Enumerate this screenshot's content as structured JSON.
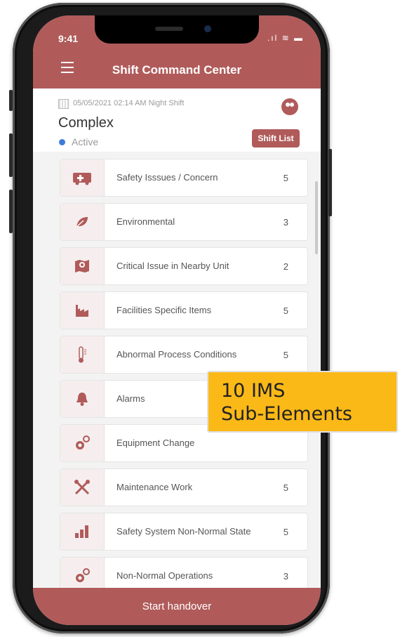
{
  "status_bar": {
    "time": "9:41",
    "icons": ".ıl ≋ ▬"
  },
  "header": {
    "title": "Shift Command Center"
  },
  "info": {
    "datetime": "05/05/2021 02:14 AM Night Shift",
    "site": "Complex",
    "status": "Active",
    "shift_list_button": "Shift List"
  },
  "items": [
    {
      "label": "Safety Isssues / Concern",
      "count": "5",
      "icon": "ambulance-icon"
    },
    {
      "label": "Environmental",
      "count": "3",
      "icon": "leaf-icon"
    },
    {
      "label": "Critical Issue in Nearby Unit",
      "count": "2",
      "icon": "map-pin-icon"
    },
    {
      "label": "Facilities Specific Items",
      "count": "5",
      "icon": "factory-icon"
    },
    {
      "label": "Abnormal Process Conditions",
      "count": "5",
      "icon": "thermometer-icon"
    },
    {
      "label": "Alarms",
      "count": "",
      "icon": "bell-icon"
    },
    {
      "label": "Equipment Change",
      "count": "",
      "icon": "gears-icon"
    },
    {
      "label": "Maintenance Work",
      "count": "5",
      "icon": "tools-icon"
    },
    {
      "label": "Safety System Non-Normal State",
      "count": "5",
      "icon": "bar-chart-icon"
    },
    {
      "label": "Non-Normal Operations",
      "count": "3",
      "icon": "gears-icon"
    }
  ],
  "footer": {
    "button": "Start handover"
  },
  "callout": {
    "line1": "10 IMS",
    "line2": "Sub-Elements"
  },
  "colors": {
    "brand": "#b05b5a",
    "callout": "#fbb917",
    "active_dot": "#3e7bd9"
  }
}
